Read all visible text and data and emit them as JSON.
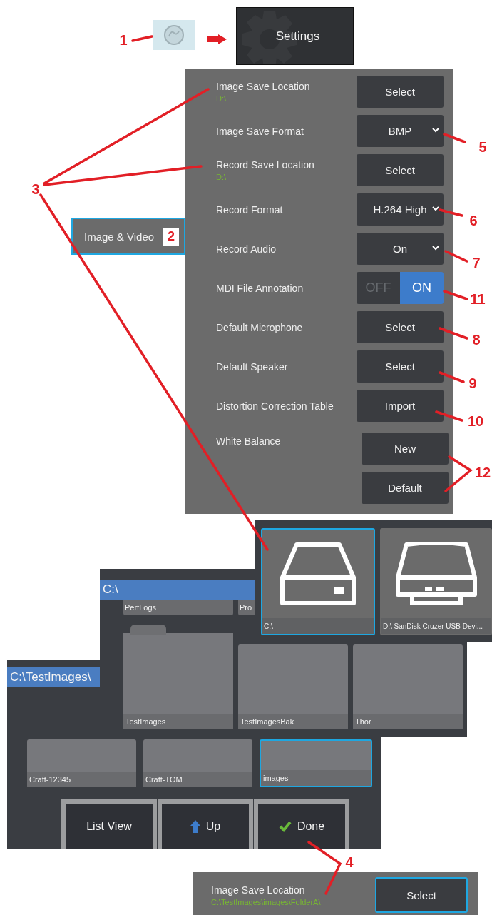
{
  "settings_tile": {
    "label": "Settings"
  },
  "menu_tab": {
    "label": "Image & Video",
    "selected": true
  },
  "settings_rows": [
    {
      "kind": "button",
      "label": "Image Save Location",
      "path": "D:\\",
      "control": "Select"
    },
    {
      "kind": "dropdown",
      "label": "Image Save Format",
      "control": "BMP"
    },
    {
      "kind": "button",
      "label": "Record Save Location",
      "path": "D:\\",
      "control": "Select"
    },
    {
      "kind": "dropdown",
      "label": "Record Format",
      "control": "H.264 High"
    },
    {
      "kind": "dropdown",
      "label": "Record Audio",
      "control": "On"
    },
    {
      "kind": "toggle",
      "label": "MDI File Annotation",
      "options": [
        {
          "label": "OFF",
          "selected": false
        },
        {
          "label": "ON",
          "selected": true
        }
      ]
    },
    {
      "kind": "button",
      "label": "Default Microphone",
      "control": "Select"
    },
    {
      "kind": "button",
      "label": "Default Speaker",
      "control": "Select"
    },
    {
      "kind": "button",
      "label": "Distortion Correction Table",
      "control": "Import"
    },
    {
      "kind": "stack",
      "label": "White Balance",
      "controls": [
        "New",
        "Default"
      ]
    }
  ],
  "drive_picker": {
    "drives": [
      {
        "kind": "hdd",
        "label": "C:\\",
        "selected": true
      },
      {
        "kind": "usb",
        "label": "D:\\ SanDisk Cruzer USB Devi...",
        "selected": false
      }
    ]
  },
  "folder_browser_root": {
    "path": "C:\\",
    "top_row": [
      {
        "label": "PerfLogs"
      },
      {
        "label": "Pro"
      }
    ],
    "folders": [
      {
        "label": "TestImages",
        "selected": false
      },
      {
        "label": "TestImagesBak",
        "selected": false
      },
      {
        "label": "Thor",
        "selected": false
      }
    ]
  },
  "folder_browser_sub": {
    "path": "C:\\TestImages\\",
    "folders": [
      {
        "label": "Craft-12345",
        "selected": false
      },
      {
        "label": "Craft-TOM",
        "selected": false
      },
      {
        "label": "images",
        "selected": true
      }
    ],
    "buttons": [
      {
        "kind": "list",
        "label": "List View"
      },
      {
        "kind": "up",
        "label": "Up"
      },
      {
        "kind": "done",
        "label": "Done"
      }
    ]
  },
  "result_row": {
    "label": "Image Save Location",
    "path": "C:\\TestImages\\images\\FolderA\\",
    "control": "Select",
    "selected": true
  },
  "badge": "2",
  "callouts": [
    "1",
    "3",
    "5",
    "6",
    "7",
    "11",
    "8",
    "9",
    "10",
    "12",
    "4"
  ]
}
